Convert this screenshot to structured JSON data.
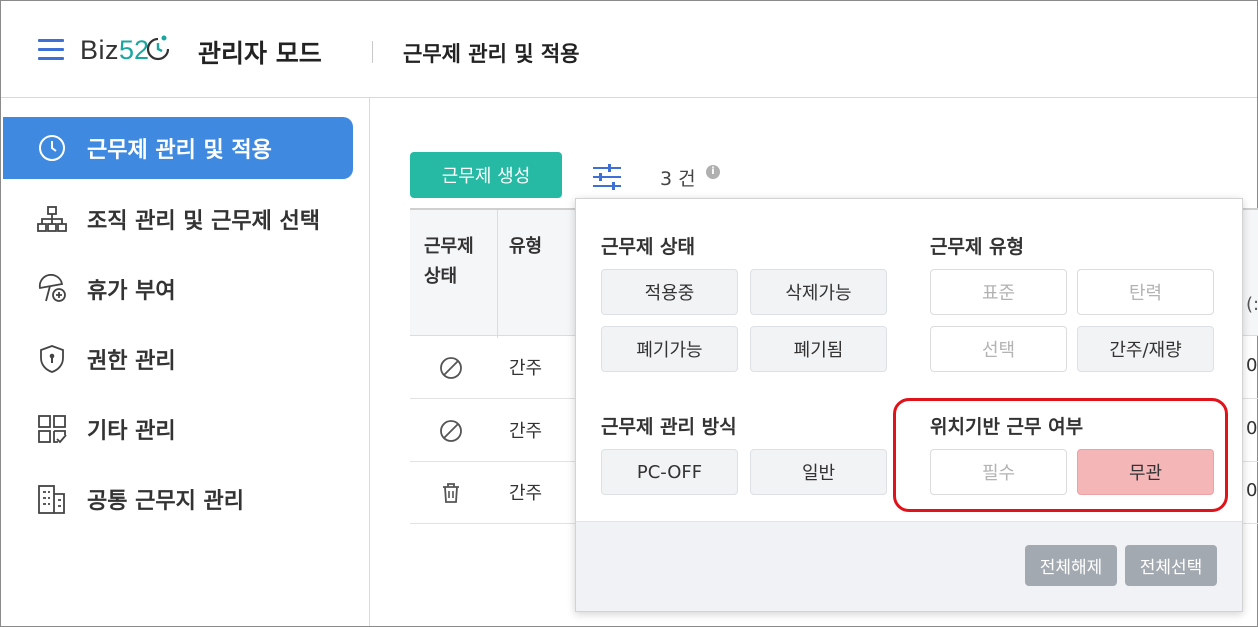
{
  "header": {
    "logo_text": "Biz",
    "logo_num": "52",
    "title": "관리자 모드",
    "subtitle": "근무제 관리 및 적용"
  },
  "sidebar": {
    "items": [
      {
        "label": "근무제 관리 및 적용",
        "icon": "clock-icon",
        "active": true
      },
      {
        "label": "조직 관리 및 근무제 선택",
        "icon": "org-chart-icon",
        "active": false
      },
      {
        "label": "휴가 부여",
        "icon": "vacation-umbrella-icon",
        "active": false
      },
      {
        "label": "권한 관리",
        "icon": "shield-icon",
        "active": false
      },
      {
        "label": "기타 관리",
        "icon": "grid-check-icon",
        "active": false
      },
      {
        "label": "공통 근무지 관리",
        "icon": "building-icon",
        "active": false
      }
    ]
  },
  "toolbar": {
    "create_label": "근무제 생성",
    "count_label": "3 건"
  },
  "table": {
    "headers": {
      "status_line1": "근무제",
      "status_line2": "상태",
      "type": "유형",
      "edge": "(:"
    },
    "rows": [
      {
        "status_icon": "prohibited-icon",
        "type": "간주",
        "edge": "0"
      },
      {
        "status_icon": "prohibited-icon",
        "type": "간주",
        "edge": "0"
      },
      {
        "status_icon": "trash-icon",
        "type": "간주",
        "edge": "0"
      }
    ]
  },
  "filter": {
    "status": {
      "title": "근무제 상태",
      "options": [
        "적용중",
        "삭제가능",
        "폐기가능",
        "폐기됨"
      ]
    },
    "type": {
      "title": "근무제 유형",
      "options": [
        "표준",
        "탄력",
        "선택",
        "간주/재량"
      ]
    },
    "method": {
      "title": "근무제 관리 방식",
      "options": [
        "PC-OFF",
        "일반"
      ]
    },
    "location": {
      "title": "위치기반 근무 여부",
      "options": [
        "필수",
        "무관"
      ]
    },
    "deselect_all": "전체해제",
    "select_all": "전체선택"
  },
  "colors": {
    "accent_blue": "#3f8ae0",
    "create_green": "#26b9a3",
    "selected_pink": "#f5b6b8",
    "highlight_red": "#e0131a"
  }
}
